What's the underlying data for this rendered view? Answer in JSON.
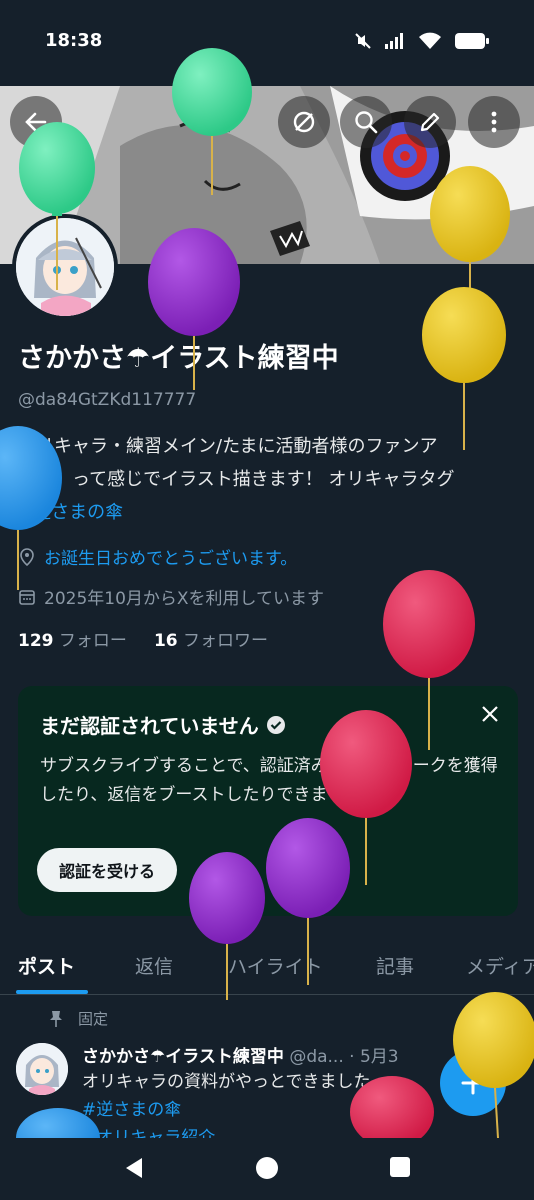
{
  "status": {
    "time": "18:38"
  },
  "header": {
    "back_icon": "back-arrow-icon",
    "actions": [
      "circle-slash-icon",
      "search-icon",
      "edit-icon",
      "more-icon"
    ]
  },
  "profile": {
    "name": "さかかさ☂イラスト練習中",
    "handle": "@da84GtZKd117777",
    "bio_line1": "オリキャラ・練習メイン/たまに活動者様のファンア",
    "bio_line2": "ート！って感じでイラスト描きます！ オリキャラタグ",
    "bio_hashtag": "#逆さまの傘",
    "birthday": "お誕生日おめでとうございます。",
    "joined": "2025年10月からXを利用しています",
    "following_count": "129",
    "following_label": "フォロー",
    "followers_count": "16",
    "followers_label": "フォロワー"
  },
  "verify_card": {
    "title": "まだ認証されていません",
    "body": "サブスクライブすることで、認証済みチェックマークを獲得したり、返信をブーストしたりできます。",
    "button": "認証を受ける"
  },
  "tabs": [
    "ポスト",
    "返信",
    "ハイライト",
    "記事",
    "メディア"
  ],
  "post": {
    "pinned_label": "固定",
    "author": "さかかさ☂イラスト練習中",
    "handle_date": "@da... · 5月3",
    "text": "オリキャラの資料がやっとできました",
    "tag1": "#逆さまの傘",
    "tag2": "#オリキャラ紹介"
  },
  "colors": {
    "background": "#15202b",
    "accent": "#1d9bf0",
    "verify_card_bg": "#07281f",
    "balloon_green": "#3ddc97",
    "balloon_purple": "#8e24c9",
    "balloon_yellow": "#e6c21a",
    "balloon_red": "#e0244f",
    "balloon_blue": "#2196f3"
  }
}
